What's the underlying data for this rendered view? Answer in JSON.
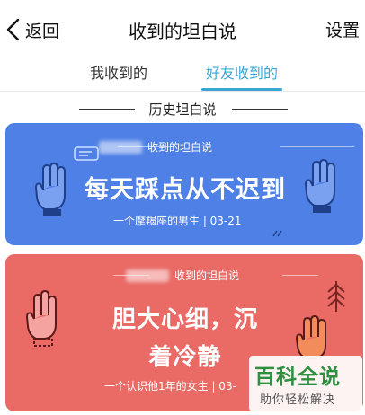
{
  "nav": {
    "back_label": "返回",
    "title": "收到的坦白说",
    "settings_label": "设置"
  },
  "tabs": [
    {
      "label": "我收到的",
      "active": false
    },
    {
      "label": "好友收到的",
      "active": true
    }
  ],
  "section": {
    "title": "历史坦白说"
  },
  "cards": [
    {
      "header": "收到的坦白说",
      "message": "每天踩点从不迟到",
      "meta": "一个摩羯座的男生 | 03-21",
      "color": "#4f80e6"
    },
    {
      "header": "收到的坦白说",
      "message_line1": "胆大心细，沉",
      "message_line2": "着冷静",
      "meta": "一个认识他1年的女生 | 03-",
      "color": "#ea6a66"
    }
  ],
  "watermark": {
    "title": "百科全说",
    "subtitle": "助你轻松解决"
  },
  "colors": {
    "accent": "#3aa6d6",
    "watermark_green": "#2f8f3f"
  },
  "icons": [
    "back-chevron-icon",
    "hand-icon",
    "ribbon-icon",
    "tree-icon",
    "sparkle-icon"
  ]
}
